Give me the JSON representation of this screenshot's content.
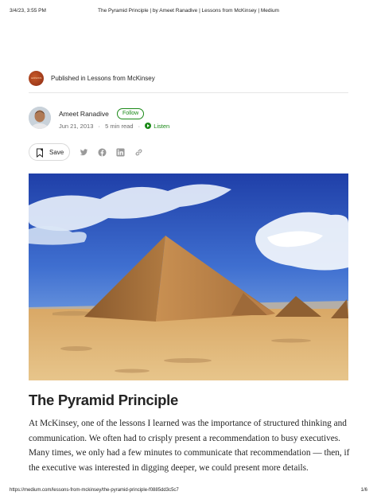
{
  "print_header": {
    "date": "3/4/23, 3:55 PM",
    "title": "The Pyramid Principle | by Ameet Ranadive | Lessons from McKinsey | Medium"
  },
  "publication": {
    "logo_text": "LESSONS",
    "label": "Published in Lessons from McKinsey"
  },
  "author": {
    "name": "Ameet Ranadive",
    "follow_label": "Follow",
    "date": "Jun 21, 2013",
    "read_time": "5 min read",
    "separator": "·",
    "listen_label": "Listen"
  },
  "actions": {
    "save_label": "Save",
    "icons": [
      "twitter-icon",
      "facebook-icon",
      "linkedin-icon",
      "link-icon"
    ]
  },
  "article": {
    "title": "The Pyramid Principle",
    "body": "At McKinsey, one of the lessons I learned was the importance of structured thinking and communication. We often had to crisply present a recommendation to busy executives. Many times, we only had a few minutes to communicate that recommendation — then, if the executive was interested in digging deeper, we could present more details."
  },
  "print_footer": {
    "url": "https://medium.com/lessons-from-mckinsey/the-pyramid-principle-f0885dd3c5c7",
    "page": "1/6"
  },
  "colors": {
    "accent_green": "#1a8917",
    "text": "#242424",
    "muted": "#6b6b6b"
  }
}
